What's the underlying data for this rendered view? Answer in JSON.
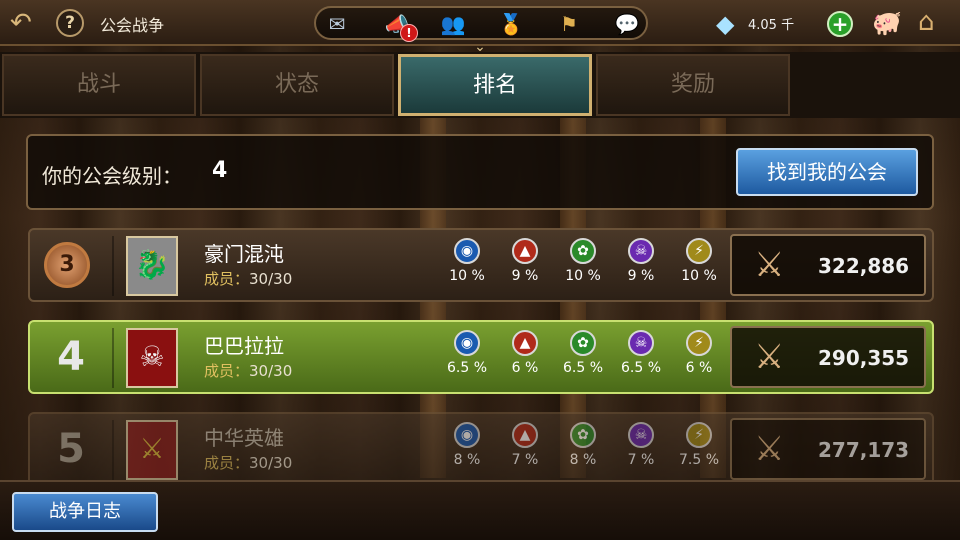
{
  "header": {
    "title": "公会战争",
    "gems": "4.05 千",
    "notification_badge": "!"
  },
  "tabs": [
    {
      "label": "战斗",
      "active": false
    },
    {
      "label": "状态",
      "active": false
    },
    {
      "label": "排名",
      "active": true
    },
    {
      "label": "奖励",
      "active": false
    }
  ],
  "level_panel": {
    "label": "你的公会级别：",
    "value": "4",
    "find_button": "找到我的公会"
  },
  "member_prefix": "成员：",
  "rankings": [
    {
      "rank": "3",
      "name": "豪门混沌",
      "members": "30/30",
      "stats": [
        "10 %",
        "9 %",
        "10 %",
        "9 %",
        "10 %"
      ],
      "score": "322,886"
    },
    {
      "rank": "4",
      "name": "巴巴拉拉",
      "members": "30/30",
      "stats": [
        "6.5 %",
        "6 %",
        "6.5 %",
        "6.5 %",
        "6 %"
      ],
      "score": "290,355"
    },
    {
      "rank": "5",
      "name": "中华英雄",
      "members": "30/30",
      "stats": [
        "8 %",
        "7 %",
        "8 %",
        "7 %",
        "7.5 %"
      ],
      "score": "277,173"
    }
  ],
  "footer": {
    "war_log_button": "战争日志"
  },
  "colors": {
    "active_tab": "#2c5a5a",
    "my_row": "#6a9028",
    "button_blue": "#2a6ab8",
    "member_text": "#e0c060"
  },
  "icons": {
    "element_order": [
      "water-icon",
      "fire-icon",
      "nature-icon",
      "dark-icon",
      "light-icon"
    ]
  }
}
